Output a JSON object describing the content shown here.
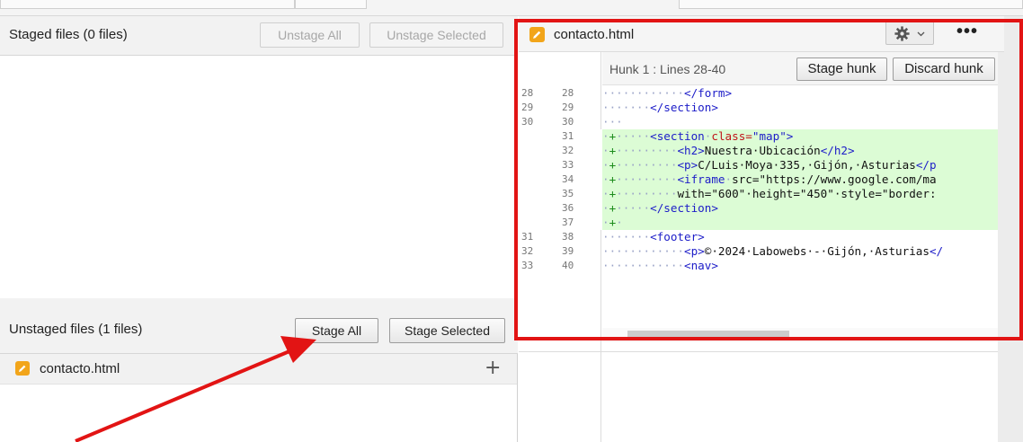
{
  "staged": {
    "title": "Staged files  (0 files)",
    "unstage_all": "Unstage All",
    "unstage_selected": "Unstage Selected"
  },
  "unstaged": {
    "title": "Unstaged files  (1 files)",
    "stage_all": "Stage All",
    "stage_selected": "Stage Selected",
    "files": [
      {
        "name": "contacto.html",
        "icon": "edit-file-icon",
        "action": "+"
      }
    ]
  },
  "diff": {
    "file": "contacto.html",
    "more": "•••",
    "hunk_label": "Hunk 1 : Lines 28-40",
    "stage_hunk": "Stage hunk",
    "discard_hunk": "Discard hunk",
    "lines": [
      {
        "old": "28",
        "new": "28",
        "type": "context"
      },
      {
        "old": "29",
        "new": "29",
        "type": "context"
      },
      {
        "old": "30",
        "new": "30",
        "type": "context"
      },
      {
        "old": "",
        "new": "31",
        "type": "added"
      },
      {
        "old": "",
        "new": "32",
        "type": "added"
      },
      {
        "old": "",
        "new": "33",
        "type": "added"
      },
      {
        "old": "",
        "new": "34",
        "type": "added"
      },
      {
        "old": "",
        "new": "35",
        "type": "added"
      },
      {
        "old": "",
        "new": "36",
        "type": "added"
      },
      {
        "old": "",
        "new": "37",
        "type": "added"
      },
      {
        "old": "31",
        "new": "38",
        "type": "context"
      },
      {
        "old": "32",
        "new": "39",
        "type": "context"
      },
      {
        "old": "33",
        "new": "40",
        "type": "context"
      }
    ],
    "code": {
      "l28": "</form>",
      "l29": "</section>",
      "l31_tag": "<section",
      "l31_attr": "class=",
      "l31_val": "\"map\">",
      "l32_open": "<h2>",
      "l32_text": "Nuestra·Ubicación",
      "l32_close": "</h2>",
      "l33_open": "<p>",
      "l33_text": "C/Luis·Moya·335,·Gijón,·Asturias",
      "l33_close": "</p",
      "l34_tag": "<iframe",
      "l34_text": "src=\"https://www.google.com/ma",
      "l35_text": "with=\"600\"·height=\"450\"·style=\"border:",
      "l36": "</section>",
      "l38": "<footer>",
      "l39_open": "<p>",
      "l39_text": "©·2024·Labowebs·-·Gijón,·Asturias",
      "l39_close": "</",
      "l40": "<nav>"
    }
  },
  "colors": {
    "annotation": "#e21414",
    "file_icon": "#f2a51a",
    "added_bg": "#dcfcd5"
  }
}
